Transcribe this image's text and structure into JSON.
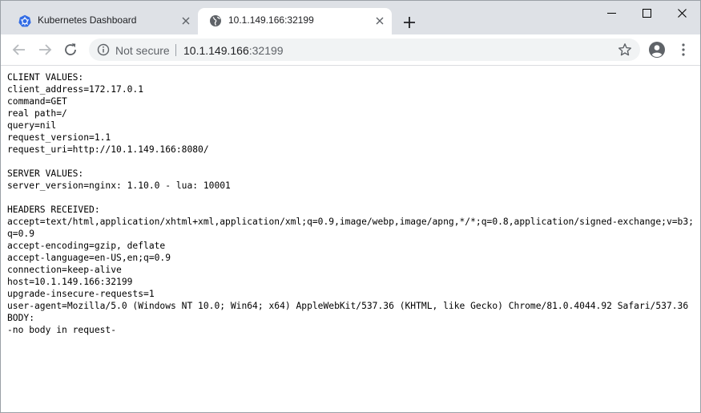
{
  "browser": {
    "tabs": [
      {
        "title": "Kubernetes Dashboard",
        "favicon": "kubernetes-icon",
        "active": false
      },
      {
        "title": "10.1.149.166:32199",
        "favicon": "globe-icon",
        "active": true
      }
    ],
    "address_bar": {
      "security_label": "Not secure",
      "host": "10.1.149.166",
      "port": ":32199"
    },
    "accent_color": "#326ce5"
  },
  "page": {
    "client_header": "CLIENT VALUES:",
    "client_lines": [
      "client_address=172.17.0.1",
      "command=GET",
      "real path=/",
      "query=nil",
      "request_version=1.1",
      "request_uri=http://10.1.149.166:8080/"
    ],
    "server_header": "SERVER VALUES:",
    "server_lines": [
      "server_version=nginx: 1.10.0 - lua: 10001"
    ],
    "headers_header": "HEADERS RECEIVED:",
    "headers_lines": [
      "accept=text/html,application/xhtml+xml,application/xml;q=0.9,image/webp,image/apng,*/*;q=0.8,application/signed-exchange;v=b3;q=0.9",
      "accept-encoding=gzip, deflate",
      "accept-language=en-US,en;q=0.9",
      "connection=keep-alive",
      "host=10.1.149.166:32199",
      "upgrade-insecure-requests=1",
      "user-agent=Mozilla/5.0 (Windows NT 10.0; Win64; x64) AppleWebKit/537.36 (KHTML, like Gecko) Chrome/81.0.4044.92 Safari/537.36"
    ],
    "body_header": "BODY:",
    "body_lines": [
      "-no body in request-"
    ]
  }
}
